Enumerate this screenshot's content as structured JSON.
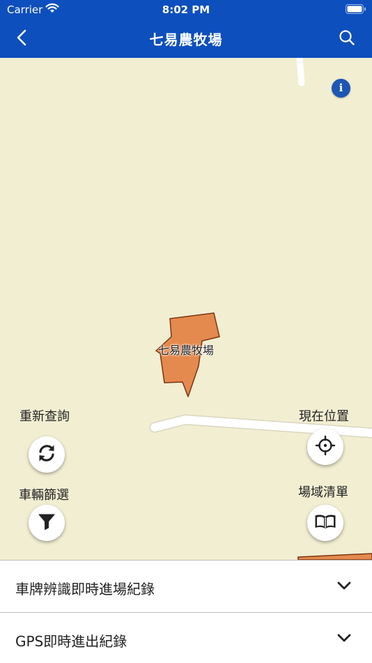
{
  "status_bar": {
    "carrier": "Carrier",
    "time": "8:02 PM"
  },
  "nav": {
    "title": "七易農牧場"
  },
  "map": {
    "farm_label": "七易農牧場",
    "info_icon": "i",
    "controls": {
      "refresh_label": "重新查詢",
      "locate_label": "現在位置",
      "filter_label": "車輛篩選",
      "list_label": "場域清單"
    }
  },
  "panels": [
    {
      "label": "車牌辨識即時進場紀錄"
    },
    {
      "label": "GPS即時進出紀錄"
    }
  ],
  "colors": {
    "nav": "#0d4fbd",
    "map_bg": "#f1eed2",
    "farm": "#e58a4e",
    "farm_outline": "#7a3410"
  },
  "icons": [
    "back-arrow-icon",
    "search-icon",
    "info-icon",
    "refresh-icon",
    "crosshair-icon",
    "filter-icon",
    "book-icon",
    "chevron-down-icon"
  ]
}
